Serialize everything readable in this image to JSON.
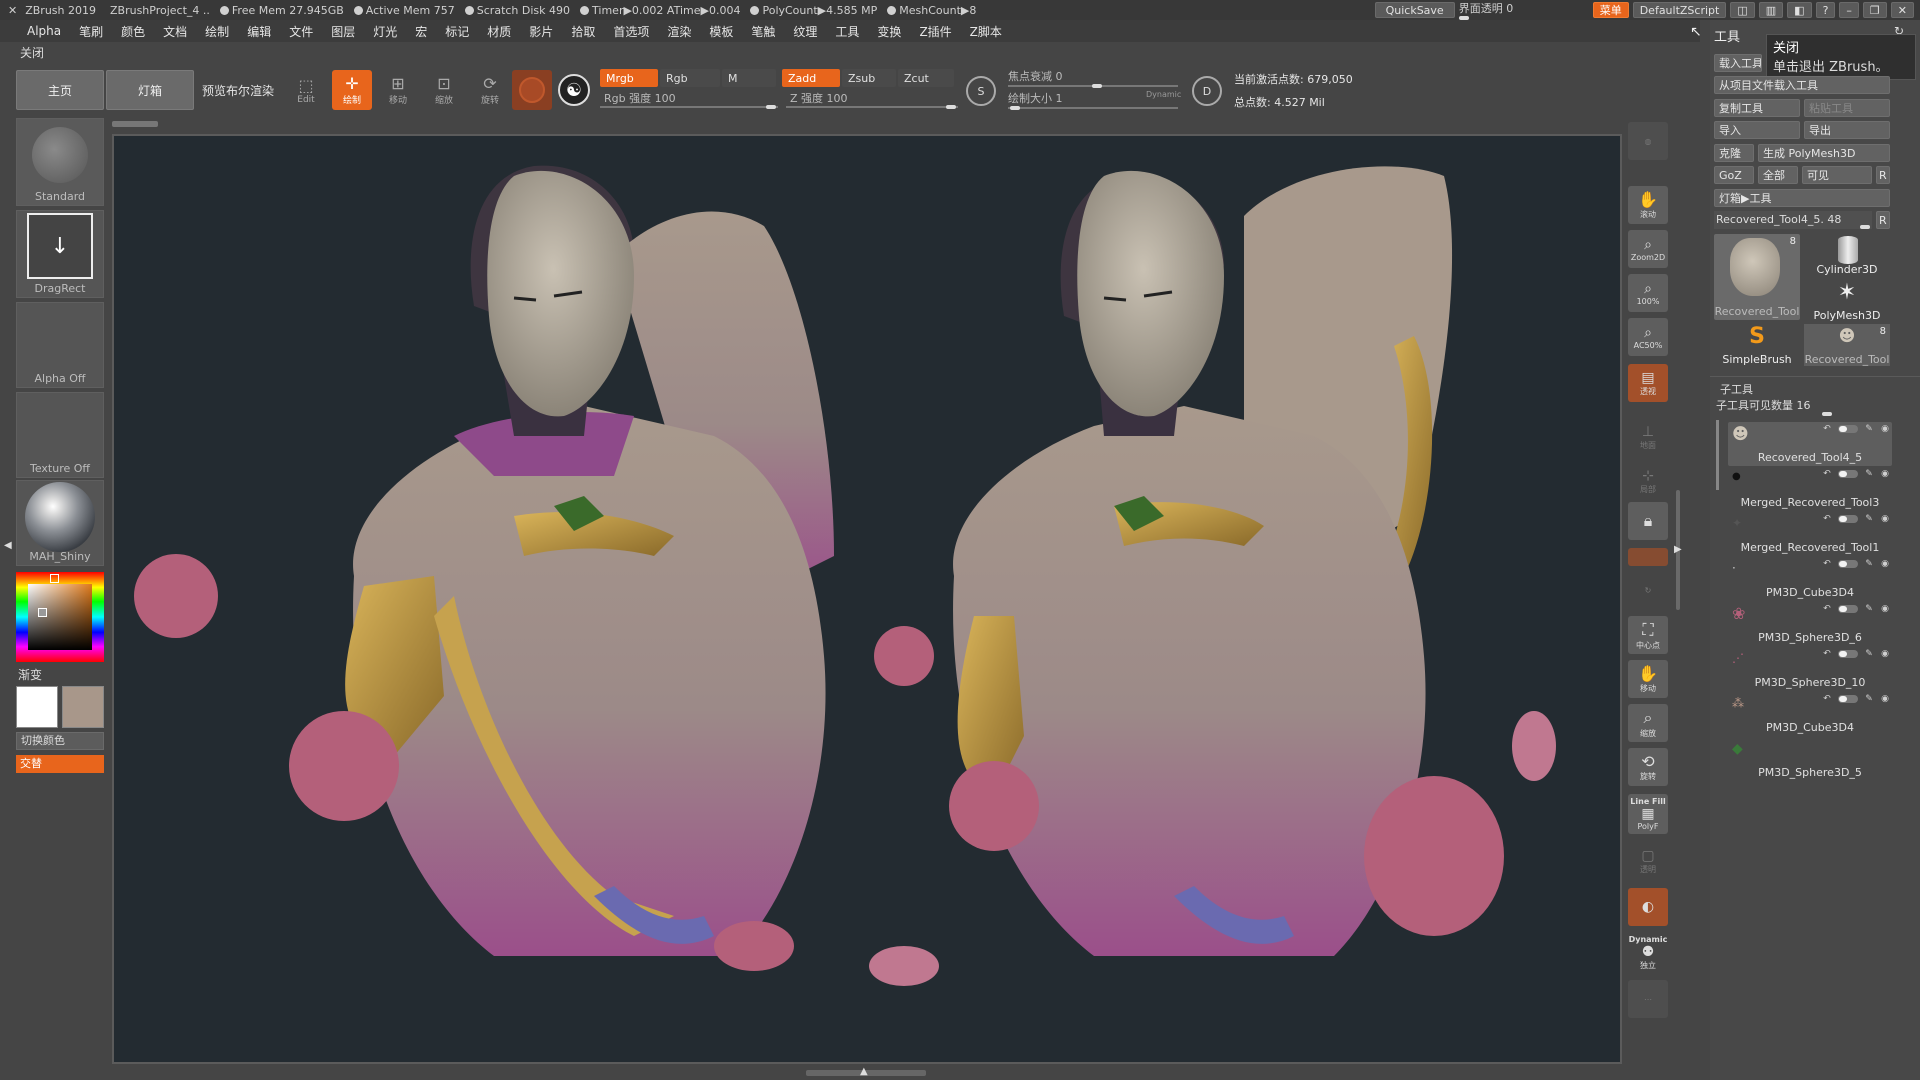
{
  "titlebar": {
    "app": "ZBrush 2019",
    "project": "ZBrushProject_4 ..",
    "free_mem": "Free Mem 27.945GB",
    "active_mem": "Active Mem 757",
    "scratch": "Scratch Disk 490",
    "timer": "Timer▶0.002 ATime▶0.004",
    "polycount": "PolyCount▶4.585 MP",
    "meshcount": "MeshCount▶8",
    "quicksave": "QuickSave",
    "ui_transparency": "界面透明 0",
    "menu_btn": "菜单",
    "script_btn": "DefaultZScript"
  },
  "menubar": {
    "items": [
      "Alpha",
      "笔刷",
      "颜色",
      "文档",
      "绘制",
      "编辑",
      "文件",
      "图层",
      "灯光",
      "宏",
      "标记",
      "材质",
      "影片",
      "拾取",
      "首选项",
      "渲染",
      "模板",
      "笔触",
      "纹理",
      "工具",
      "变换",
      "Z插件",
      "Z脚本"
    ],
    "close": "关闭"
  },
  "shelf": {
    "home": "主页",
    "lightbox": "灯箱",
    "bpr": "预览布尔渲染",
    "edit": "Edit",
    "draw": "绘制",
    "move": "移动",
    "scale": "缩放",
    "rotate": "旋转",
    "mrgb": "Mrgb",
    "rgb": "Rgb",
    "m": "M",
    "rgb_intensity": "Rgb 强度 100",
    "zadd": "Zadd",
    "zsub": "Zsub",
    "zcut": "Zcut",
    "z_intensity": "Z 强度 100",
    "focal_shift": "焦点衰减 0",
    "draw_size": "绘制大小 1",
    "dynamic": "Dynamic",
    "active_points": "当前激活点数: 679,050",
    "total_points": "总点数: 4.527 Mil"
  },
  "left": {
    "brush": "Standard",
    "stroke": "DragRect",
    "alpha": "Alpha Off",
    "texture": "Texture Off",
    "material": "MAH_Shiny",
    "gradient": "渐变",
    "switch_color": "切换颜色",
    "alternate": "交替"
  },
  "right_toolbar": {
    "scroll": "滚动",
    "zoom2d": "Zoom2D",
    "actual": "100%",
    "half": "AC50%",
    "persp": "透视",
    "floor": "地面",
    "local": "局部",
    "frame": "中心点",
    "move": "移动",
    "zoom": "缩放",
    "rotate": "旋转",
    "linefill": "Line Fill",
    "polyf": "PolyF",
    "transp": "透明",
    "dynamic": "Dynamic",
    "solo": "独立"
  },
  "tool_panel": {
    "header": "工具",
    "tooltip_title": "关闭",
    "tooltip_text": "单击退出 ZBrush。",
    "load_tool": "载入工具",
    "load_from_project": "从项目文件载入工具",
    "copy_tool": "复制工具",
    "paste_tool": "粘贴工具",
    "import": "导入",
    "export": "导出",
    "clone": "克隆",
    "make_polymesh": "生成 PolyMesh3D",
    "goz": "GoZ",
    "all": "全部",
    "visible": "可见",
    "r": "R",
    "lightbox_tools": "灯箱▶工具",
    "current_tool": "Recovered_Tool4_5. 48",
    "thumbs": [
      {
        "label": "Recovered_Tool",
        "count": "8"
      },
      {
        "label": "Cylinder3D",
        "count": ""
      },
      {
        "label": "PolyMesh3D",
        "count": ""
      },
      {
        "label": "SimpleBrush",
        "count": ""
      },
      {
        "label": "Recovered_Tool",
        "count": "8"
      }
    ],
    "subtool_header": "子工具",
    "subtool_visible": "子工具可见数量 16",
    "subtools": [
      "Recovered_Tool4_5",
      "Merged_Recovered_Tool3",
      "Merged_Recovered_Tool1",
      "PM3D_Cube3D4",
      "PM3D_Sphere3D_6",
      "PM3D_Sphere3D_10",
      "PM3D_Cube3D4",
      "PM3D_Sphere3D_5"
    ]
  },
  "colors": {
    "accent": "#e8651c",
    "viewport_bg": "#232b31",
    "panel_bg": "#454545"
  }
}
